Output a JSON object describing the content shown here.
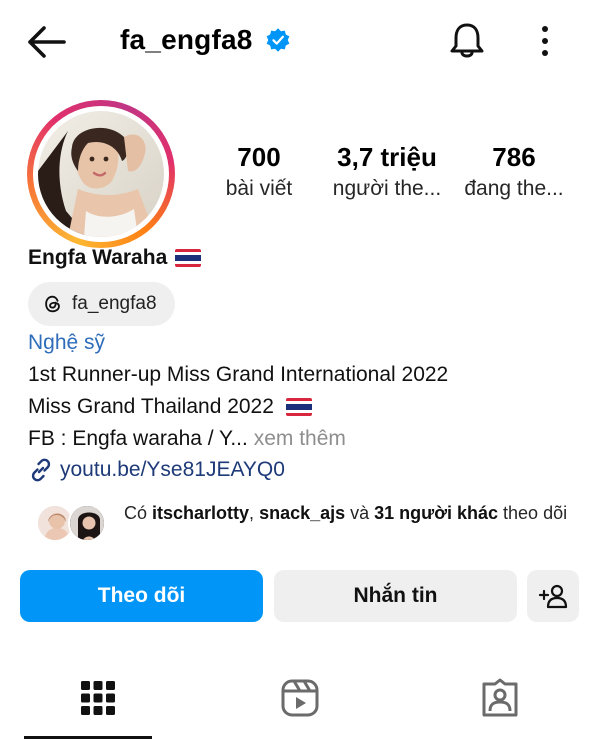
{
  "header": {
    "username": "fa_engfa8",
    "verified": true,
    "back_icon": "arrow-left-icon",
    "notification_icon": "bell-icon",
    "more_icon": "vertical-dots-icon"
  },
  "profile": {
    "display_name": "Engfa Waraha",
    "name_flag": "thailand-flag",
    "stats": [
      {
        "value": "700",
        "label": "bài viết"
      },
      {
        "value": "3,7 triệu",
        "label": "người the..."
      },
      {
        "value": "786",
        "label": "đang the..."
      }
    ],
    "threads_handle": "fa_engfa8",
    "category": "Nghệ sỹ",
    "bio_line1": "1st Runner-up Miss Grand International 2022",
    "bio_line2": "Miss Grand Thailand 2022",
    "bio_line3": "FB : Engfa waraha  / Y...",
    "bio_more": " xem thêm",
    "link": "youtu.be/Yse81JEAYQ0"
  },
  "followed_by": {
    "prefix": "Có ",
    "user1": "itscharlotty",
    "sep": ", ",
    "user2": "snack_ajs",
    "and": " và ",
    "others": "31 người khác",
    "suffix": " theo dõi"
  },
  "actions": {
    "follow_label": "Theo dõi",
    "message_label": "Nhắn tin",
    "suggest_icon": "add-person-icon"
  },
  "tabs": [
    {
      "icon": "grid-icon",
      "active": true
    },
    {
      "icon": "reels-icon",
      "active": false
    },
    {
      "icon": "tagged-icon",
      "active": false
    }
  ],
  "colors": {
    "follow_button": "#0095f6",
    "verified_badge": "#0095f6",
    "category_text": "#2f6dbb",
    "link_text": "#1e3a78"
  }
}
